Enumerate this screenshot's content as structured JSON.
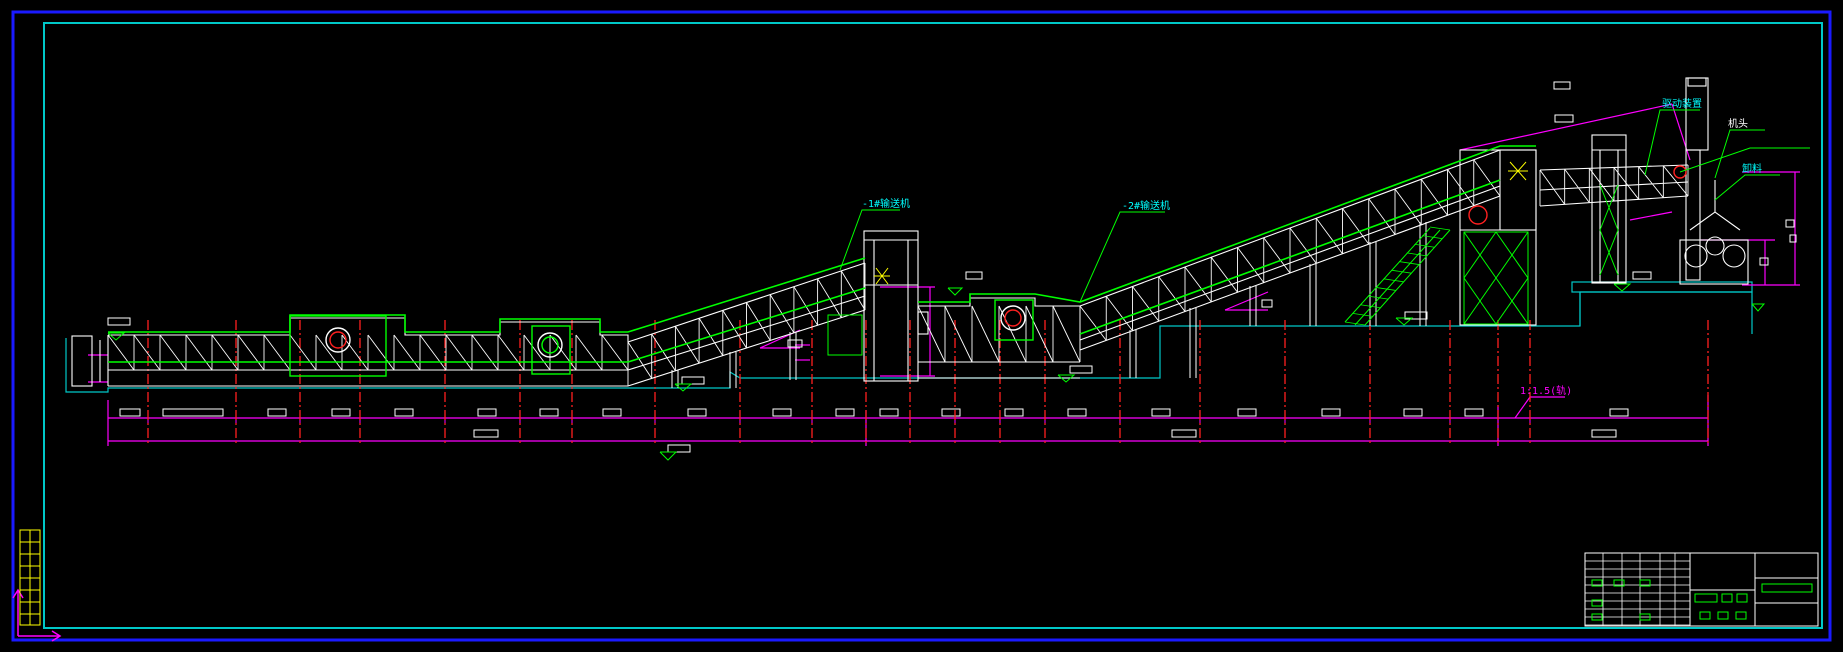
{
  "colors": {
    "background": "#000000",
    "outer_frame": "#1a1aff",
    "inner_frame": "#00c8c8",
    "structure": "#ffffff",
    "belt": "#00ff00",
    "centerline": "#ff2020",
    "dimension": "#ff00ff",
    "annotation": "#00ffff",
    "highlight": "#ffff00"
  },
  "drawing": {
    "leaders": [
      {
        "text": "-1#输送机"
      },
      {
        "text": "-2#输送机"
      },
      {
        "text": "驱动装置"
      },
      {
        "text": "机头"
      },
      {
        "text": "卸料"
      },
      {
        "text": "1:1.5(轨)"
      }
    ],
    "title_block": {
      "visible": true
    }
  }
}
